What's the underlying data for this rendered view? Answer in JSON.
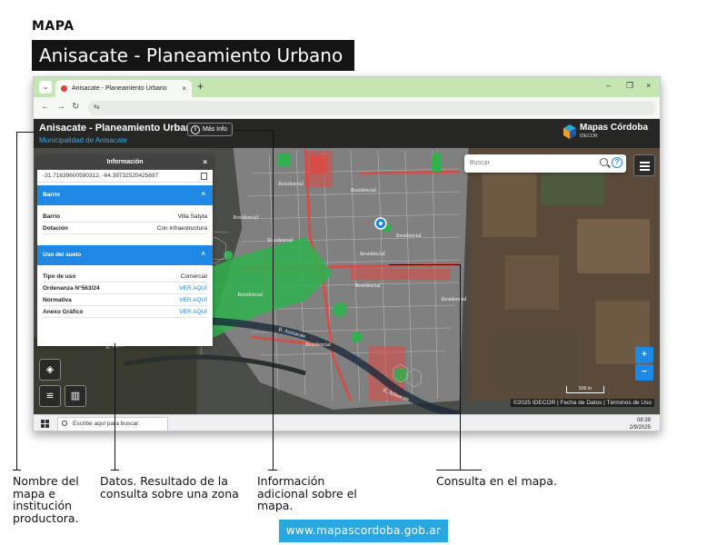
{
  "header": {
    "section_label": "MAPA",
    "banner_title": "Anisacate - Planeamiento Urbano"
  },
  "browser": {
    "tab_title": "Anisacate - Planeamiento Urbano",
    "tab_close": "×",
    "new_tab": "+",
    "dropdown_glyph": "⌄",
    "minimize": "–",
    "maximize": "❐",
    "close": "×",
    "back": "←",
    "forward": "→",
    "reload": "↻",
    "site_info_icon": "⇆"
  },
  "app": {
    "title": "Anisacate - Planeamiento Urbano",
    "subtitle": "Municipalidad de Anisacate",
    "mas_info_icon": "i",
    "mas_info": "Más Info",
    "logo_text": "Mapas Córdoba",
    "logo_sub": "IDECOR",
    "search_placeholder": "Buscar",
    "help_glyph": "?",
    "scale_label": "500 m",
    "attribution": "©2025 IDECOR | Fecha de Datos | Términos de Uso",
    "zoom_in": "+",
    "zoom_out": "−",
    "map_labels": [
      "Residencial",
      "Residencial",
      "Residencial",
      "Residencial",
      "Residencial",
      "Residencial",
      "Residencial",
      "Residencial",
      "Residencial",
      "Residencial",
      "R. Anizacate",
      "R. Anizacate",
      "R. Anizacate"
    ]
  },
  "info_panel": {
    "title": "Información",
    "close_glyph": "×",
    "coords": "-31.71639600590312, -64.39732520425697",
    "sections": [
      {
        "title": "Barrio",
        "chevron": "^",
        "rows": [
          {
            "key": "Barrio",
            "value": "Villa Satyta",
            "link": false
          },
          {
            "key": "Dotación",
            "value": "Con infraestructura",
            "link": false
          }
        ]
      },
      {
        "title": "Uso del suelo",
        "chevron": "^",
        "rows": [
          {
            "key": "Tipo de uso",
            "value": "Comercial",
            "link": false
          },
          {
            "key": "Ordenanza N°563/24",
            "value": "VER AQUÍ",
            "link": true
          },
          {
            "key": "Normativa",
            "value": "VER AQUÍ",
            "link": true
          },
          {
            "key": "Anexo Gráfico",
            "value": "VER AQUÍ",
            "link": true
          }
        ]
      }
    ]
  },
  "tools": {
    "layers_glyph": "◈",
    "chart_glyph": "≌",
    "map_glyph": "▥"
  },
  "taskbar": {
    "search_text": "Escribe aquí para buscar.",
    "time": "08:39",
    "date": "2/9/2025"
  },
  "callouts": {
    "name": "Nombre del mapa e institución productora.",
    "data": "Datos. Resultado de la consulta sobre una zona",
    "more_info": "Información adicional sobre el mapa.",
    "query": "Consulta en el mapa."
  },
  "footer": {
    "url": "www.mapascordoba.gob.ar"
  },
  "colors": {
    "accent_blue": "#1e88e5",
    "urban_red": "#e0473f",
    "green_zone": "#2fb24c",
    "footer_blue": "#29a8e0"
  }
}
